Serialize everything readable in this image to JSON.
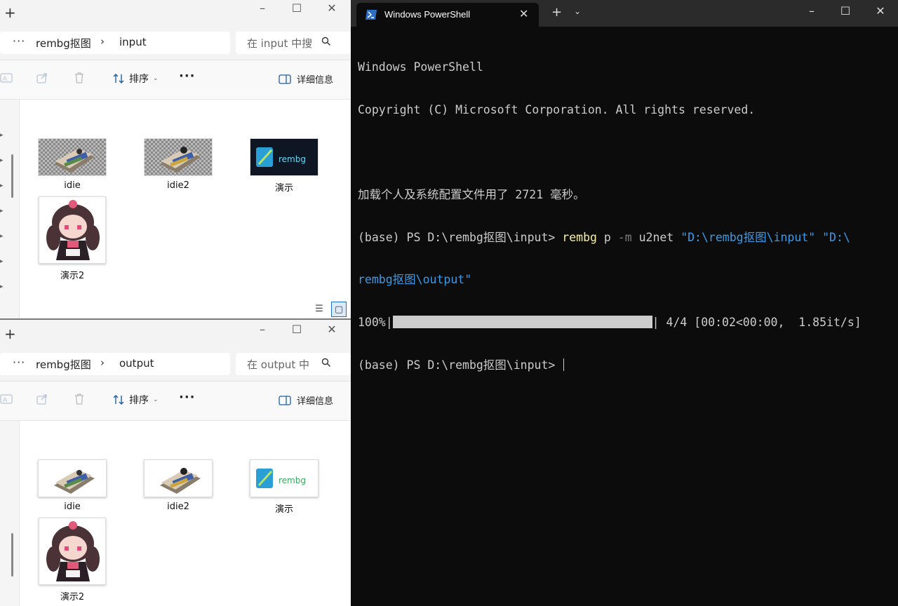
{
  "explorer_input": {
    "breadcrumb": [
      "rembg抠图",
      "input"
    ],
    "search_placeholder": "在 input 中搜",
    "sort_label": "排序",
    "details_label": "详细信息",
    "files": [
      {
        "name": "idie"
      },
      {
        "name": "idie2"
      },
      {
        "name": "演示"
      },
      {
        "name": "演示2"
      }
    ]
  },
  "explorer_output": {
    "breadcrumb": [
      "rembg抠图",
      "output"
    ],
    "search_placeholder": "在 output 中",
    "sort_label": "排序",
    "details_label": "详细信息",
    "files": [
      {
        "name": "idie"
      },
      {
        "name": "idie2"
      },
      {
        "name": "演示"
      },
      {
        "name": "演示2"
      }
    ]
  },
  "thumbnail_text": "rembg",
  "terminal": {
    "tab_title": "Windows PowerShell",
    "lines": {
      "l1": "Windows PowerShell",
      "l2": "Copyright (C) Microsoft Corporation. All rights reserved.",
      "l3": "加载个人及系统配置文件用了 2721 毫秒。",
      "prompt": "(base) PS D:\\rembg抠图\\input> ",
      "cmd": "rembg",
      "arg1": " p ",
      "flag": "-m",
      "arg2": " u2net ",
      "path1": "\"D:\\rembg抠图\\input\"",
      "path2_a": " \"D:\\",
      "path2_b": "rembg抠图\\output\"",
      "pct": "100%|",
      "progress_stats": "| 4/4 [00:02<00:00,  1.85it/s]",
      "prompt2": "(base) PS D:\\rembg抠图\\input> "
    },
    "progress": 1.0
  },
  "colors": {
    "terminal_bg": "#0c0c0c",
    "terminal_text": "#cccccc",
    "command_yellow": "#f9f1a5",
    "string_blue": "#3b9ae8",
    "explorer_bg": "#f9f9f9"
  }
}
